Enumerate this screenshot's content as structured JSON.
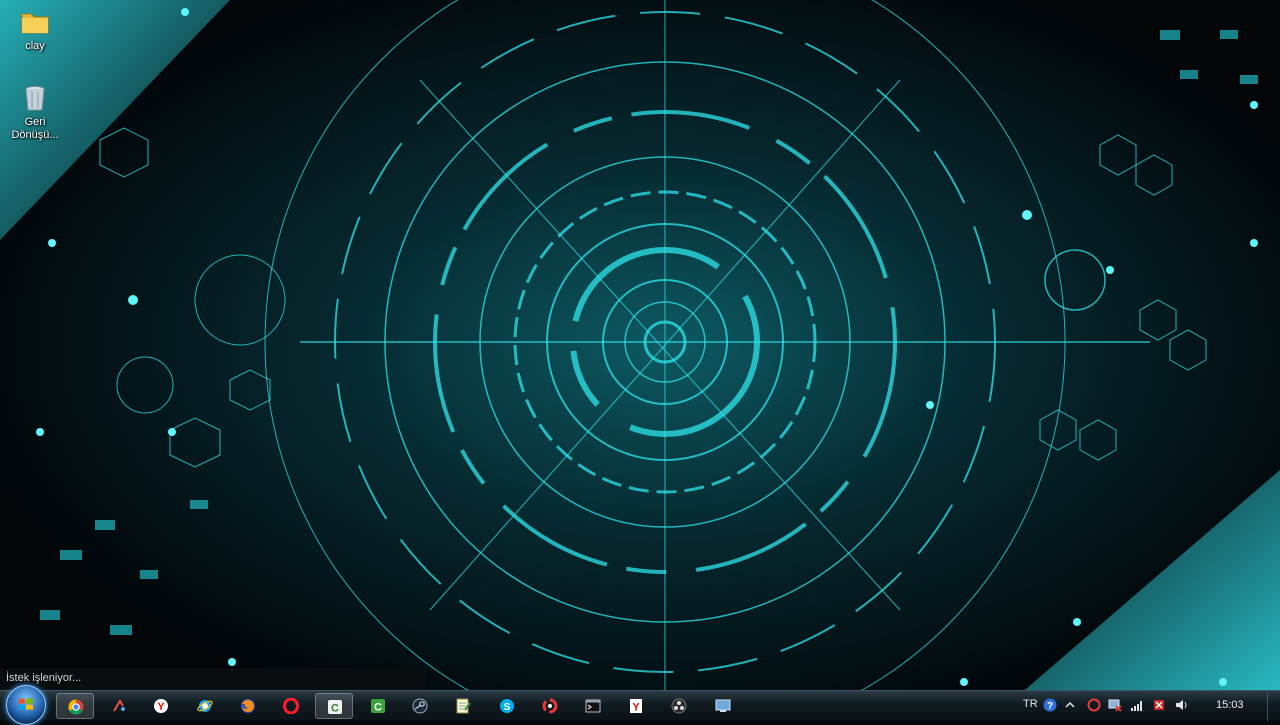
{
  "desktop": {
    "icons": [
      {
        "label": "clay"
      },
      {
        "label": "Geri Dönüşü..."
      }
    ]
  },
  "status_tip": {
    "text": "İstek işleniyor..."
  },
  "taskbar": {
    "pinned": [
      {
        "icon": "chrome-icon"
      },
      {
        "icon": "media-player-icon"
      },
      {
        "icon": "yandex-browser-icon"
      },
      {
        "icon": "internet-explorer-icon"
      },
      {
        "icon": "firefox-icon"
      },
      {
        "icon": "opera-icon"
      },
      {
        "icon": "camtasia-icon"
      },
      {
        "icon": "camtasia-recorder-icon"
      },
      {
        "icon": "steam-icon"
      },
      {
        "icon": "notepad-icon"
      },
      {
        "icon": "skype-icon"
      },
      {
        "icon": "antivirus-icon"
      },
      {
        "icon": "command-prompt-icon"
      },
      {
        "icon": "yandex-icon"
      },
      {
        "icon": "obs-icon"
      },
      {
        "icon": "remote-desktop-icon"
      }
    ],
    "tray": {
      "language": "TR",
      "clock": "15:03"
    }
  }
}
